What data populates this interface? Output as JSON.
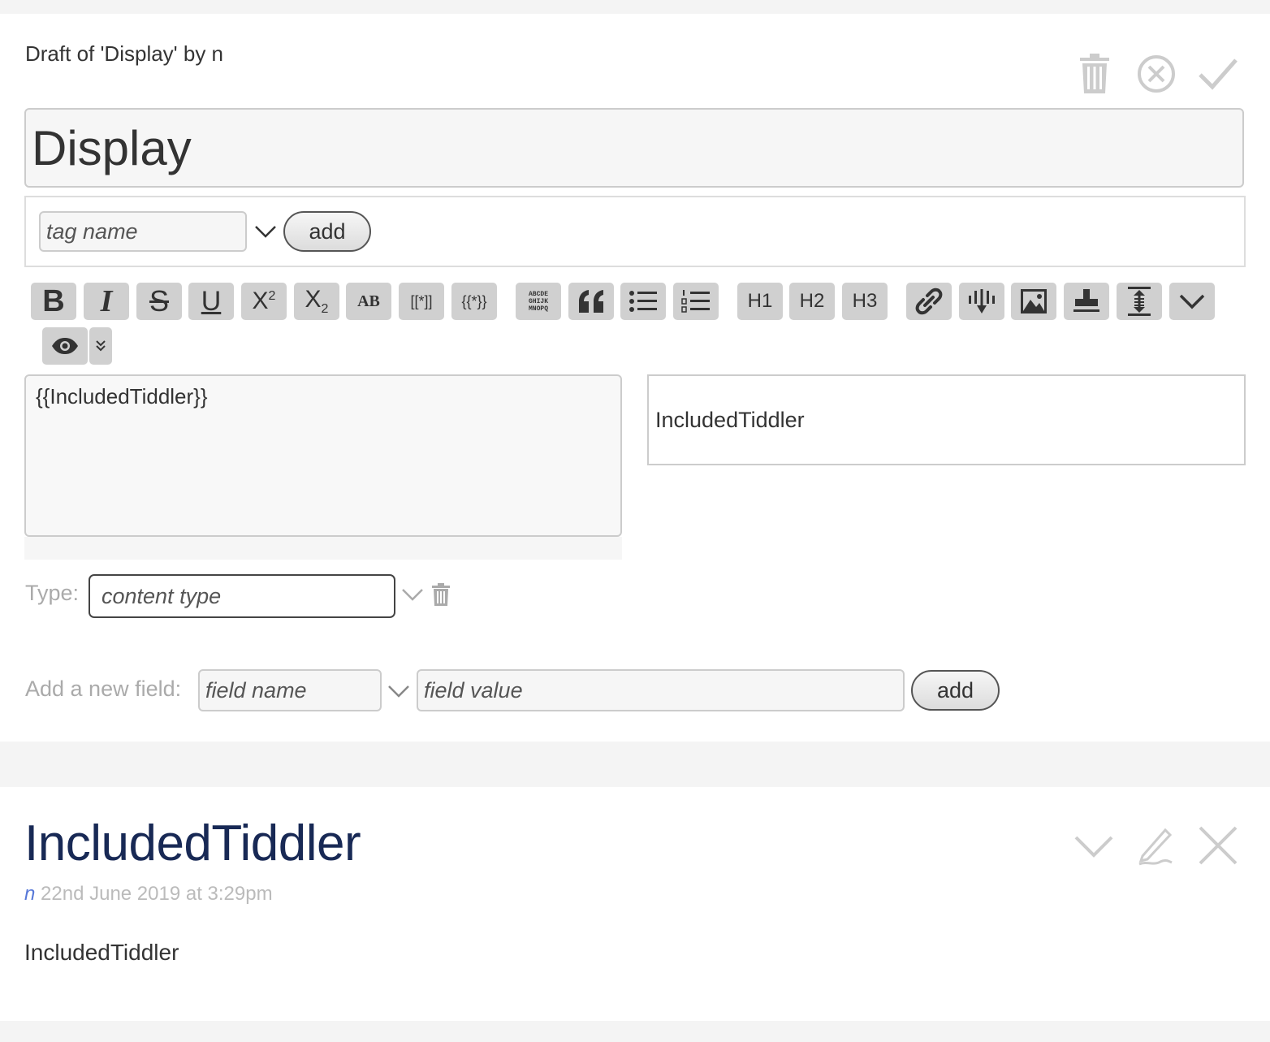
{
  "edit": {
    "draft_heading": "Draft of 'Display' by n",
    "title_value": "Display",
    "tag_placeholder": "tag name",
    "tag_add_label": "add",
    "toolbar": {
      "bold": "B",
      "italic": "I",
      "strike": "S",
      "underline": "U",
      "sup_base": "X",
      "sup_exp": "2",
      "sub_base": "X",
      "sub_exp": "2",
      "smallcaps": "AB",
      "wikilink": "[[*]]",
      "transclude": "{{*}}",
      "mono_lines": [
        "ABCDE",
        "GHIJK",
        "MNOPQ"
      ],
      "h1": "H1",
      "h2": "H2",
      "h3": "H3"
    },
    "editor_text": "{{IncludedTiddler}}",
    "preview_text": "IncludedTiddler",
    "type_label": "Type:",
    "type_placeholder": "content type",
    "field_label": "Add a new field:",
    "field_name_placeholder": "field name",
    "field_value_placeholder": "field value",
    "field_add_label": "add"
  },
  "view": {
    "title": "IncludedTiddler",
    "modifier": "n",
    "modified": "22nd June 2019 at 3:29pm",
    "body": "IncludedTiddler"
  },
  "icons": {
    "edit_controls": [
      "trash-icon",
      "cancel-icon",
      "done-icon"
    ],
    "view_controls": [
      "more-icon",
      "edit-icon",
      "close-icon"
    ]
  },
  "colors": {
    "page_bg": "#f4f4f4",
    "card_bg": "#ffffff",
    "button_bg": "#d0d0d0",
    "view_title": "#182955",
    "modifier_link": "#5778d8",
    "muted_text": "#aaaaaa"
  }
}
